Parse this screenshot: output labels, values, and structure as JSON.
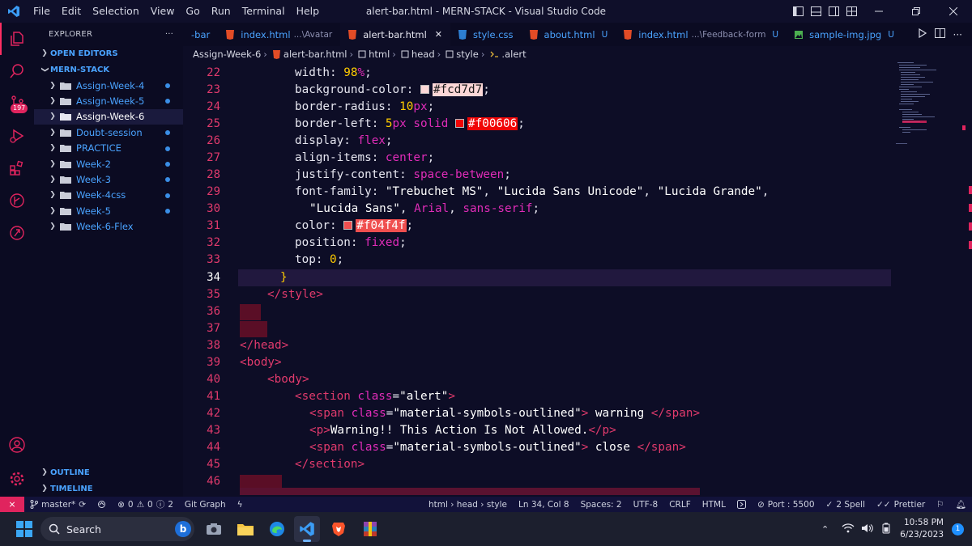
{
  "titlebar": {
    "menu": [
      "File",
      "Edit",
      "Selection",
      "View",
      "Go",
      "Run",
      "Terminal",
      "Help"
    ],
    "title": "alert-bar.html - MERN-STACK - Visual Studio Code"
  },
  "activity": {
    "scm_badge": "197"
  },
  "sidebar": {
    "header": "EXPLORER",
    "more": "···",
    "open_editors": "OPEN EDITORS",
    "workspace": "MERN-STACK",
    "folders": [
      {
        "label": "Assign-Week-4",
        "dot": true
      },
      {
        "label": "Assign-Week-5",
        "dot": true
      },
      {
        "label": "Assign-Week-6",
        "dot": false,
        "selected": true
      },
      {
        "label": "Doubt-session",
        "dot": true
      },
      {
        "label": "PRACTICE",
        "dot": true
      },
      {
        "label": "Week-2",
        "dot": true
      },
      {
        "label": "Week-3",
        "dot": true
      },
      {
        "label": "Week-4css",
        "dot": true
      },
      {
        "label": "Week-5",
        "dot": true
      },
      {
        "label": "Week-6-Flex",
        "dot": false
      }
    ],
    "outline": "OUTLINE",
    "timeline": "TIMELINE"
  },
  "tabs": [
    {
      "name": "-bar",
      "sub": "",
      "suffix": ""
    },
    {
      "name": "index.html",
      "sub": "...\\Avatar",
      "suffix": ""
    },
    {
      "name": "alert-bar.html",
      "sub": "",
      "suffix": "",
      "active": true,
      "close": "✕"
    },
    {
      "name": "style.css",
      "sub": "",
      "suffix": ""
    },
    {
      "name": "about.html",
      "sub": "",
      "suffix": "U"
    },
    {
      "name": "index.html",
      "sub": "...\\Feedback-form",
      "suffix": "U"
    },
    {
      "name": "sample-img.jpg",
      "sub": "",
      "suffix": "U"
    }
  ],
  "breadcrumb": [
    "Assign-Week-6",
    "alert-bar.html",
    "html",
    "head",
    "style",
    ".alert"
  ],
  "colors": {
    "swatch1": "#fcd7d7",
    "swatch2": "#f00606",
    "swatch3": "#f04f4f"
  },
  "code": {
    "l22": {
      "num": "22",
      "prop": "width",
      "val": "98",
      "unit": "%"
    },
    "l23": {
      "num": "23",
      "prop": "background-color",
      "val": "#fcd7d7"
    },
    "l24": {
      "num": "24",
      "prop": "border-radius",
      "val": "10",
      "unit": "px"
    },
    "l25": {
      "num": "25",
      "prop": "border-left",
      "val": "5",
      "unit": "px",
      "kw": "solid",
      "color": "#f00606"
    },
    "l26": {
      "num": "26",
      "prop": "display",
      "val": "flex"
    },
    "l27": {
      "num": "27",
      "prop": "align-items",
      "val": "center"
    },
    "l28": {
      "num": "28",
      "prop": "justify-content",
      "val": "space-between"
    },
    "l29": {
      "num": "29",
      "prop": "font-family",
      "v1": "\"Trebuchet MS\"",
      "v2": "\"Lucida Sans Unicode\"",
      "v3": "\"Lucida Grande\""
    },
    "l30": {
      "num": "30",
      "v1": "\"Lucida Sans\"",
      "v2": "Arial",
      "v3": "sans-serif"
    },
    "l31": {
      "num": "31",
      "prop": "color",
      "val": "#f04f4f"
    },
    "l32": {
      "num": "32",
      "prop": "position",
      "val": "fixed"
    },
    "l33": {
      "num": "33",
      "prop": "top",
      "val": "0"
    },
    "l34": {
      "num": "34",
      "text": "}"
    },
    "l35": {
      "num": "35",
      "text": "</style>"
    },
    "l36": {
      "num": "36"
    },
    "l37": {
      "num": "37"
    },
    "l38": {
      "num": "38",
      "text": "</head>"
    },
    "l39": {
      "num": "39",
      "text": "<body>"
    },
    "l40": {
      "num": "40",
      "text": "<body>"
    },
    "l41": {
      "num": "41",
      "open": "<section",
      "attr": "class",
      "sval": "\"alert\"",
      "close": ">"
    },
    "l42": {
      "num": "42",
      "open": "<span",
      "attr": "class",
      "sval": "\"material-symbols-outlined\"",
      "close": ">",
      "text": " warning ",
      "end": "</span>"
    },
    "l43": {
      "num": "43",
      "open": "<p>",
      "text": "Warning!! This Action Is Not Allowed.",
      "end": "</p>"
    },
    "l44": {
      "num": "44",
      "open": "<span",
      "attr": "class",
      "sval": "\"material-symbols-outlined\"",
      "close": ">",
      "text": " close ",
      "end": "</span>"
    },
    "l45": {
      "num": "45",
      "text": "</section>"
    },
    "l46": {
      "num": "46"
    }
  },
  "status": {
    "branch": "master*",
    "errors": "0",
    "warnings": "0",
    "info": "2",
    "git_graph": "Git Graph",
    "path": "html › head › style",
    "position": "Ln 34, Col 8",
    "spaces": "Spaces: 2",
    "encoding": "UTF-8",
    "eol": "CRLF",
    "language": "HTML",
    "port": "Port : 5500",
    "spell": "2 Spell",
    "prettier": "Prettier"
  },
  "taskbar": {
    "search_placeholder": "Search",
    "time": "10:58 PM",
    "date": "6/23/2023",
    "notifications": "1"
  }
}
